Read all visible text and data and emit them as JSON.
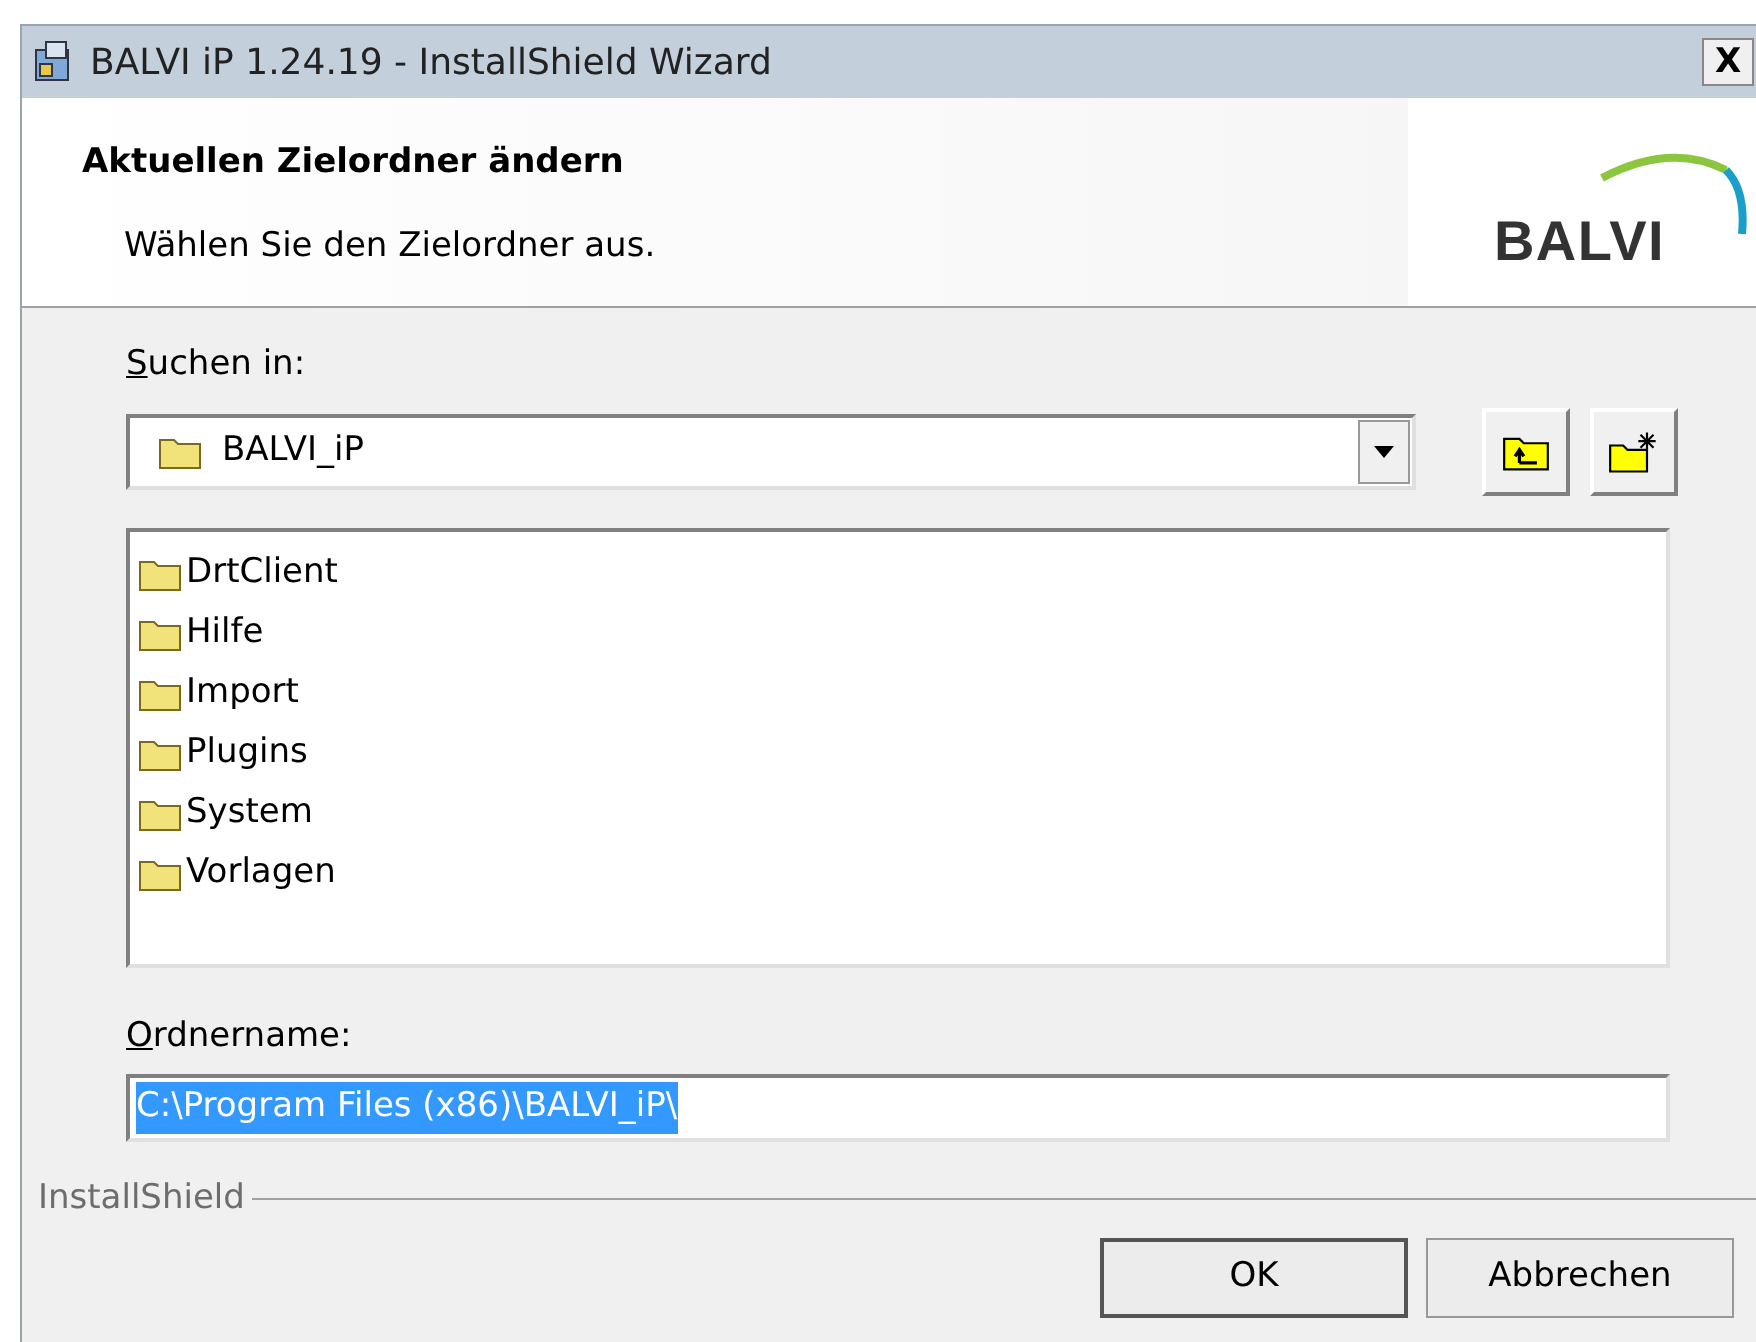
{
  "window": {
    "title": "BALVI iP 1.24.19 - InstallShield Wizard",
    "close_label": "X"
  },
  "header": {
    "title": "Aktuellen Zielordner ändern",
    "subtitle": "Wählen Sie den Zielordner aus.",
    "logo_text": "BALVI"
  },
  "look_in": {
    "label": [
      {
        "text": "S",
        "underlined": true
      },
      {
        "text": "uchen in:",
        "underlined": false
      }
    ],
    "value": "BALVI_iP"
  },
  "folders": [
    {
      "name": "DrtClient"
    },
    {
      "name": "Hilfe"
    },
    {
      "name": "Import"
    },
    {
      "name": "Plugins"
    },
    {
      "name": "System"
    },
    {
      "name": "Vorlagen"
    }
  ],
  "folder_name": {
    "label": [
      {
        "text": "O",
        "underlined": true
      },
      {
        "text": "rdnername:",
        "underlined": false
      }
    ],
    "value": "C:\\Program Files (x86)\\BALVI_iP\\",
    "selected": true
  },
  "footer": {
    "brand": "InstallShield"
  },
  "buttons": [
    {
      "label": "OK",
      "kind": "default"
    },
    {
      "label": "Abbrechen",
      "kind": "normal"
    }
  ]
}
